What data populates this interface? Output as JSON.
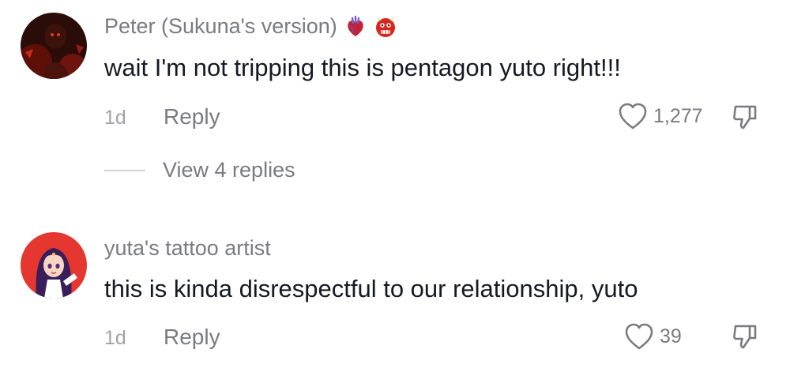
{
  "comments": [
    {
      "username": "Peter (Sukuna's version)",
      "badges": [
        "anatomical-heart-emoji",
        "ogre-emoji"
      ],
      "text": "wait I'm not tripping this is pentagon yuto right!!!",
      "time": "1d",
      "reply_label": "Reply",
      "likes": "1,277",
      "view_replies_label": "View 4 replies",
      "colors": {
        "avatar_bg": "#2a0c08",
        "avatar_accent": "#c4261a"
      }
    },
    {
      "username": "yuta's tattoo artist",
      "text": "this is kinda disrespectful to our relationship, yuto",
      "time": "1d",
      "reply_label": "Reply",
      "likes": "39",
      "colors": {
        "avatar_bg": "#e5362f",
        "avatar_hair": "#3a1e5c"
      }
    }
  ],
  "icons": {
    "like": "heart-outline-icon",
    "dislike": "thumbs-down-outline-icon"
  },
  "theme": {
    "text_primary": "#161823",
    "text_secondary": "#7a7b80",
    "text_tertiary": "#a1a2a7",
    "divider": "#d0d1d3"
  }
}
